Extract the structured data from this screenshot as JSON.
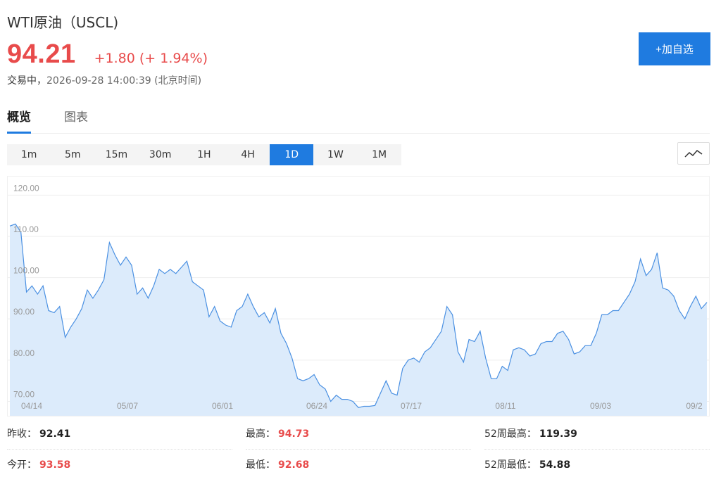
{
  "header": {
    "title": "WTI原油（USCL)",
    "price": "94.21",
    "change": "+1.80 (+ 1.94%)",
    "status_label": "交易中，",
    "status_time": "2026-09-28 14:00:39 (北京时间)",
    "watch_button": "+加自选"
  },
  "tabs": [
    {
      "label": "概览",
      "active": true
    },
    {
      "label": "图表",
      "active": false
    }
  ],
  "intervals": [
    {
      "label": "1m",
      "active": false
    },
    {
      "label": "5m",
      "active": false
    },
    {
      "label": "15m",
      "active": false
    },
    {
      "label": "30m",
      "active": false
    },
    {
      "label": "1H",
      "active": false
    },
    {
      "label": "4H",
      "active": false
    },
    {
      "label": "1D",
      "active": true
    },
    {
      "label": "1W",
      "active": false
    },
    {
      "label": "1M",
      "active": false
    }
  ],
  "chart_type_icon": "line-chart-icon",
  "chart_data": {
    "type": "area",
    "y_ticks": [
      "120.00",
      "110.00",
      "100.00",
      "90.00",
      "80.00",
      "70.00"
    ],
    "x_ticks": [
      "04/14",
      "05/07",
      "06/01",
      "06/24",
      "07/17",
      "08/11",
      "09/03",
      "09/2"
    ],
    "ylim": [
      66.5,
      124.5
    ],
    "grid": true,
    "line_color": "#4a90e2",
    "fill_color": "#dcebfb",
    "values": [
      112.5,
      113,
      111,
      96.5,
      98,
      96,
      98,
      92,
      91.5,
      93,
      85.5,
      88,
      90,
      92.5,
      97,
      95,
      97,
      99.5,
      108.5,
      105.5,
      103,
      105,
      103,
      96,
      97.5,
      95,
      98,
      102,
      101,
      102,
      101,
      102.5,
      104,
      99,
      98,
      97,
      90.5,
      93,
      89.5,
      88.5,
      88,
      92,
      93,
      96,
      93,
      90.5,
      91.5,
      89,
      92.5,
      86.5,
      84,
      80.5,
      75.5,
      75,
      75.5,
      76.5,
      74,
      73,
      70,
      71.5,
      70.5,
      70.5,
      70,
      68.5,
      68.8,
      68.8,
      69,
      72,
      75,
      72,
      71.5,
      78,
      80,
      80.5,
      79.5,
      82,
      83,
      85,
      87,
      93,
      91,
      82,
      79.5,
      85,
      84.5,
      87,
      80.5,
      75.5,
      75.5,
      78.5,
      77.5,
      82.5,
      83,
      82.5,
      81,
      81.5,
      84,
      84.5,
      84.5,
      86.5,
      87,
      85,
      81.5,
      82,
      83.5,
      83.5,
      86.5,
      91,
      91,
      92,
      92,
      94,
      96,
      99,
      104.5,
      100.5,
      102,
      106,
      97.5,
      97,
      95.5,
      92,
      90,
      93,
      95.5,
      92.5,
      94
    ]
  },
  "stats": {
    "prev_close_label": "昨收：",
    "prev_close": "92.41",
    "high_label": "最高：",
    "high": "94.73",
    "high52_label": "52周最高：",
    "high52": "119.39",
    "open_label": "今开：",
    "open": "93.58",
    "low_label": "最低：",
    "low": "92.68",
    "low52_label": "52周最低：",
    "low52": "54.88"
  }
}
